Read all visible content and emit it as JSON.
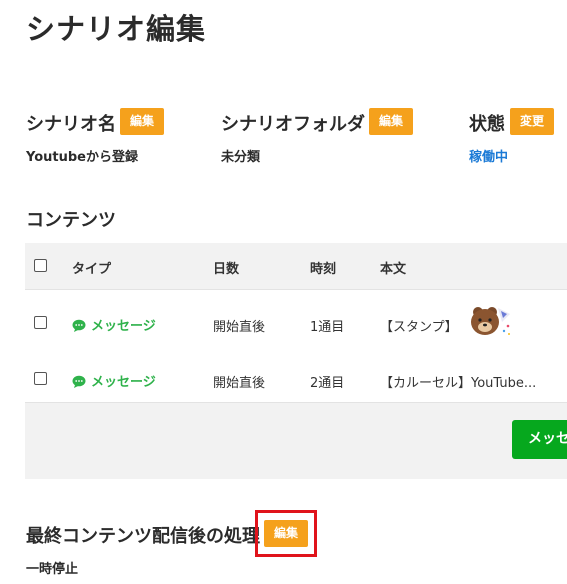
{
  "page": {
    "title": "シナリオ編集"
  },
  "scenario_name": {
    "label": "シナリオ名",
    "button": "編集",
    "value": "Youtubeから登録"
  },
  "scenario_folder": {
    "label": "シナリオフォルダ",
    "button": "編集",
    "value": "未分類"
  },
  "status": {
    "label": "状態",
    "button": "変更",
    "value": "稼働中"
  },
  "contents": {
    "title": "コンテンツ",
    "columns": [
      "タイプ",
      "日数",
      "時刻",
      "本文"
    ],
    "rows": [
      {
        "type": "メッセージ",
        "day": "開始直後",
        "time": "1通目",
        "body": "【スタンプ】"
      },
      {
        "type": "メッセージ",
        "day": "開始直後",
        "time": "2通目",
        "body": "【カルーセル】YouTube..."
      }
    ],
    "add_button": "メッセ"
  },
  "after_last": {
    "title": "最終コンテンツ配信後の処理",
    "button": "編集",
    "value": "一時停止"
  },
  "colors": {
    "orange": "#f5a11c",
    "green": "#06a81e",
    "link": "#1b7ad6",
    "message_green": "#2fb24b",
    "highlight": "#e0131b"
  }
}
